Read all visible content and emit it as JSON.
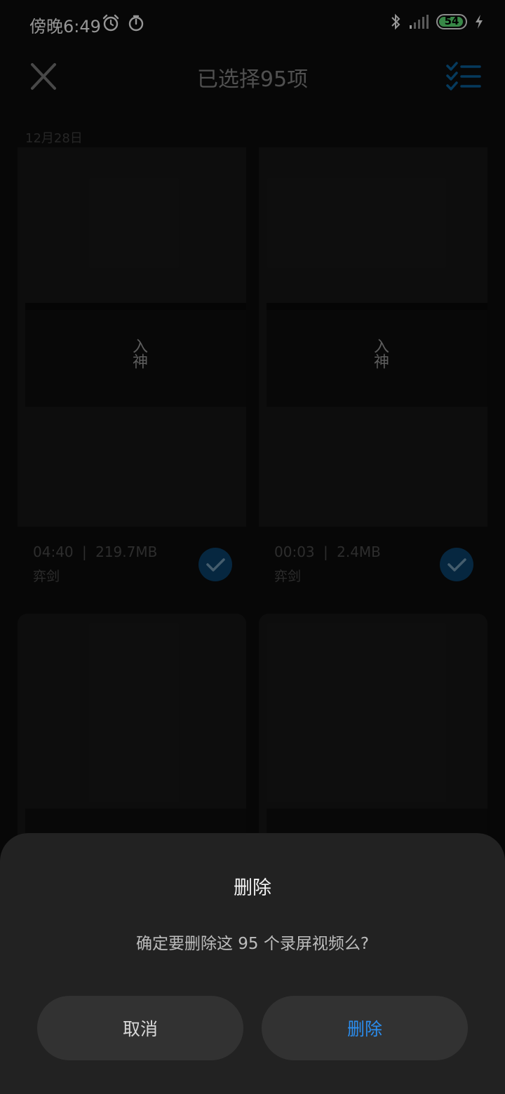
{
  "status": {
    "time": "傍晚6:49",
    "battery": "54",
    "icons_left": [
      "alarm-icon",
      "timer-icon"
    ],
    "icons_right": [
      "bluetooth-icon",
      "signal-icon",
      "battery-icon",
      "charging-icon"
    ],
    "battery_color": "#56d26d"
  },
  "header": {
    "title": "已选择95项",
    "accent": "#0a5a8f"
  },
  "section": {
    "date": "12月28日"
  },
  "items": [
    {
      "duration": "04:40",
      "size": "219.7MB",
      "app": "弈剑",
      "selected": true
    },
    {
      "duration": "00:03",
      "size": "2.4MB",
      "app": "弈剑",
      "selected": true
    }
  ],
  "meta_separator": "|",
  "dialog": {
    "title": "删除",
    "message": "确定要删除这 95 个录屏视频么?",
    "cancel": "取消",
    "confirm": "删除",
    "confirm_color": "#2b8ef0"
  }
}
